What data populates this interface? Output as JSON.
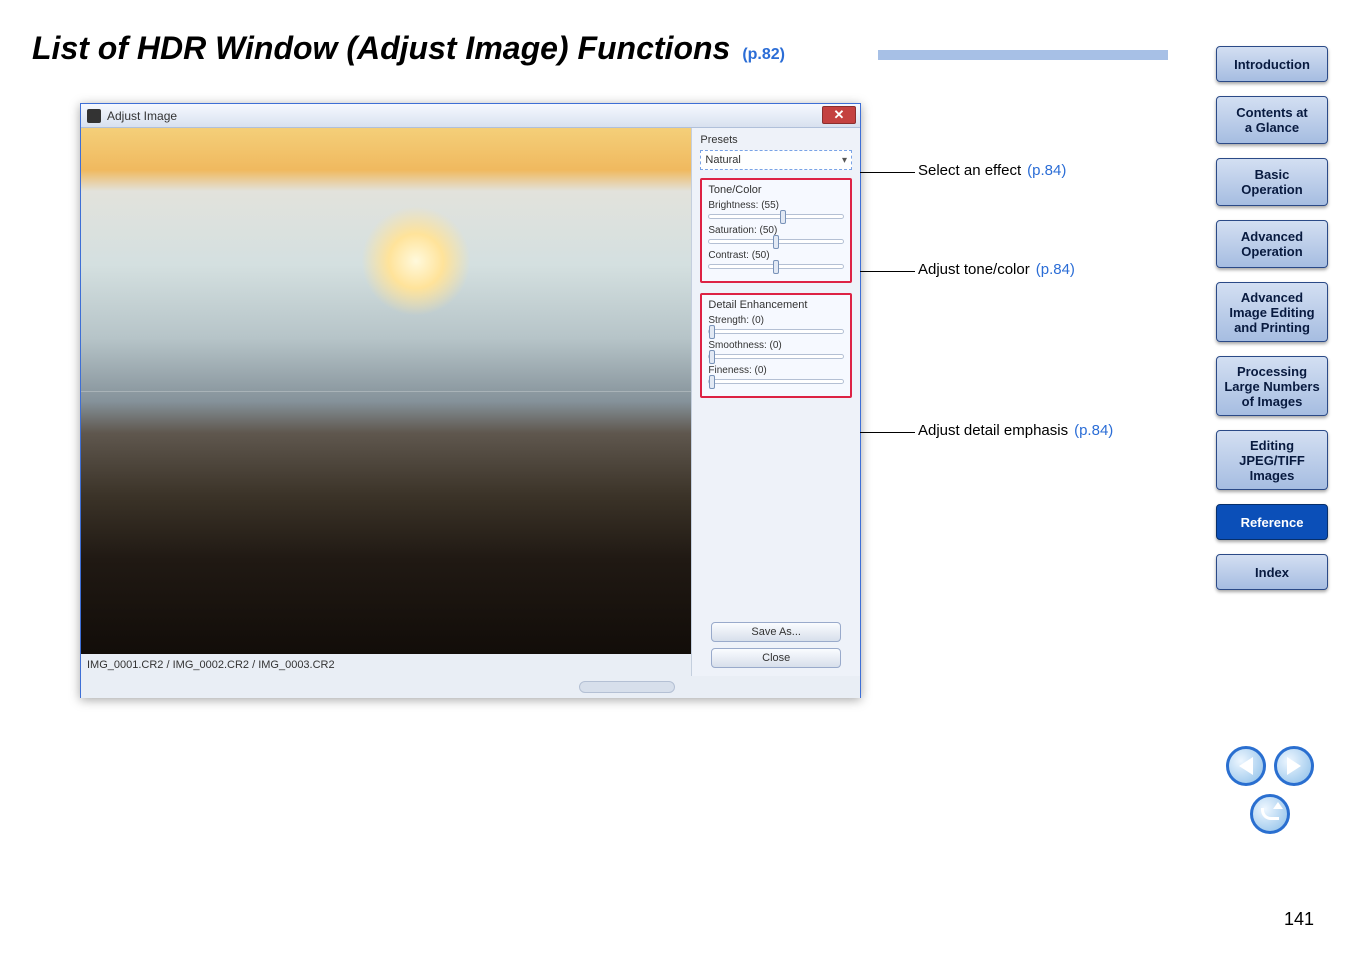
{
  "heading": {
    "title": "List of HDR Window (Adjust Image) Functions",
    "page_ref": "(p.82)"
  },
  "window": {
    "title": "Adjust Image",
    "caption": "IMG_0001.CR2 / IMG_0002.CR2 / IMG_0003.CR2"
  },
  "panel": {
    "presets_label": "Presets",
    "presets_value": "Natural",
    "tone_color": {
      "title": "Tone/Color",
      "brightness_label": "Brightness: (55)",
      "saturation_label": "Saturation: (50)",
      "contrast_label": "Contrast: (50)"
    },
    "detail": {
      "title": "Detail Enhancement",
      "strength_label": "Strength: (0)",
      "smoothness_label": "Smoothness: (0)",
      "fineness_label": "Fineness: (0)"
    },
    "save_as": "Save As...",
    "close": "Close"
  },
  "callouts": {
    "c1": {
      "text": "Select an effect",
      "ref": "(p.84)"
    },
    "c2": {
      "text": "Adjust tone/color",
      "ref": "(p.84)"
    },
    "c3": {
      "text": "Adjust detail emphasis",
      "ref": "(p.84)"
    }
  },
  "nav": {
    "intro": "Introduction",
    "contents": "Contents at\na Glance",
    "basic": "Basic\nOperation",
    "advop": "Advanced\nOperation",
    "advimg": "Advanced\nImage Editing\nand Printing",
    "proc": "Processing\nLarge Numbers\nof Images",
    "jpeg": "Editing\nJPEG/TIFF\nImages",
    "ref": "Reference",
    "index": "Index"
  },
  "page_number": "141"
}
